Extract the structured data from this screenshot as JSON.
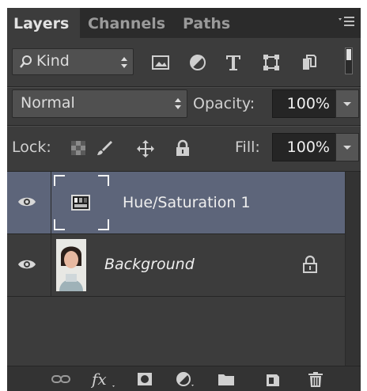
{
  "tabs": [
    {
      "label": "Layers",
      "active": true
    },
    {
      "label": "Channels",
      "active": false
    },
    {
      "label": "Paths",
      "active": false
    }
  ],
  "filter": {
    "kind_label": "Kind",
    "icons": [
      "pixel-layer-filter-icon",
      "adjustment-layer-filter-icon",
      "type-layer-filter-icon",
      "shape-layer-filter-icon",
      "smart-object-filter-icon"
    ]
  },
  "blend": {
    "mode": "Normal",
    "opacity_label": "Opacity:",
    "opacity_value": "100%"
  },
  "lock": {
    "label": "Lock:",
    "fill_label": "Fill:",
    "fill_value": "100%"
  },
  "layers": [
    {
      "name": "Hue/Saturation 1",
      "selected": true,
      "visible": true
    },
    {
      "name": "Background",
      "selected": false,
      "visible": true,
      "locked": true
    }
  ],
  "bottom_icons": [
    "link-layers-icon",
    "layer-style-fx-icon",
    "add-mask-icon",
    "new-adjustment-layer-icon",
    "new-group-icon",
    "new-layer-icon",
    "delete-layer-icon"
  ],
  "colors": {
    "panel_bg": "#3c3c3c",
    "selected_row": "#5d657a"
  }
}
